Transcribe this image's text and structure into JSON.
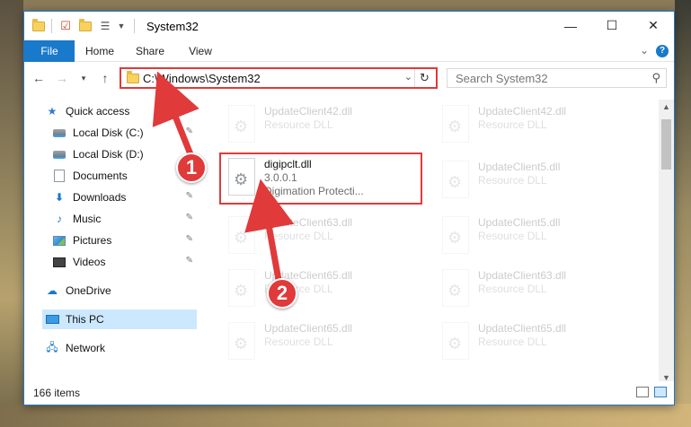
{
  "window": {
    "title": "System32",
    "controls": {
      "minimize": "—",
      "maximize": "☐",
      "close": "✕"
    }
  },
  "ribbon": {
    "tabs": [
      "File",
      "Home",
      "Share",
      "View"
    ],
    "collapse_icon": "chevron-down-icon",
    "help_label": "?"
  },
  "navigation": {
    "address": "C:\\Windows\\System32",
    "search_placeholder": "Search System32"
  },
  "sidebar": {
    "items": [
      {
        "label": "Quick access",
        "icon": "star-icon",
        "pinned": false
      },
      {
        "label": "Local Disk (C:)",
        "icon": "drive-icon",
        "pinned": true
      },
      {
        "label": "Local Disk (D:)",
        "icon": "drive-icon",
        "pinned": true
      },
      {
        "label": "Documents",
        "icon": "documents-icon",
        "pinned": true
      },
      {
        "label": "Downloads",
        "icon": "downloads-icon",
        "pinned": true
      },
      {
        "label": "Music",
        "icon": "music-icon",
        "pinned": true
      },
      {
        "label": "Pictures",
        "icon": "pictures-icon",
        "pinned": true
      },
      {
        "label": "Videos",
        "icon": "videos-icon",
        "pinned": true
      },
      {
        "label": "OneDrive",
        "icon": "onedrive-icon",
        "pinned": false
      },
      {
        "label": "This PC",
        "icon": "this-pc-icon",
        "pinned": false,
        "selected": true
      },
      {
        "label": "Network",
        "icon": "network-icon",
        "pinned": false
      }
    ]
  },
  "files": {
    "left_column": [
      {
        "name": "UpdateClient42.dll",
        "type": "Resource DLL",
        "faded": true
      },
      {
        "name": "digipclt.dll",
        "version": "3.0.0.1",
        "description": "Digimation Protecti...",
        "faded": false
      },
      {
        "name": "UpdateClient63.dll",
        "type": "Resource DLL",
        "faded": true
      },
      {
        "name": "UpdateClient65.dll",
        "type": "Resource DLL",
        "faded": true
      },
      {
        "name": "UpdateClient65.dll",
        "type": "Resource DLL",
        "faded": true
      }
    ],
    "right_column": [
      {
        "name": "UpdateClient42.dll",
        "type": "Resource DLL"
      },
      {
        "name": "UpdateClient5.dll",
        "type": "Resource DLL"
      },
      {
        "name": "UpdateClient5.dll",
        "type": "Resource DLL"
      },
      {
        "name": "UpdateClient63.dll",
        "type": "Resource DLL"
      },
      {
        "name": "UpdateClient65.dll",
        "type": "Resource DLL"
      }
    ]
  },
  "status": {
    "item_count": "166 items"
  },
  "annotations": {
    "step1": "1",
    "step2": "2",
    "color": "#e03a3a"
  }
}
